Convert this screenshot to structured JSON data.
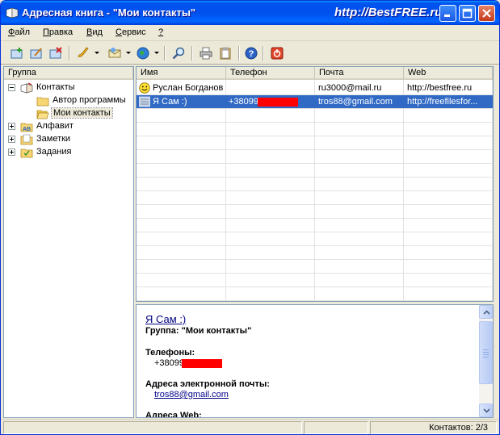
{
  "window": {
    "title": "Адресная книга - \"Мои контакты\"",
    "brand": "http://BestFREE.ru"
  },
  "menu": [
    {
      "label": "Файл",
      "mnemonic": "Ф",
      "rest": "айл"
    },
    {
      "label": "Правка",
      "mnemonic": "П",
      "rest": "равка"
    },
    {
      "label": "Вид",
      "mnemonic": "В",
      "rest": "ид"
    },
    {
      "label": "Сервис",
      "mnemonic": "С",
      "rest": "ервис"
    },
    {
      "label": "?",
      "mnemonic": "?",
      "rest": ""
    }
  ],
  "toolbar": {
    "icons": [
      "new-contact-icon",
      "edit-contact-icon",
      "delete-contact-icon",
      "phone-icon",
      "email-icon",
      "web-icon",
      "search-icon",
      "print-icon",
      "clipboard-icon",
      "help-icon",
      "exit-icon"
    ]
  },
  "tree": {
    "header": "Группа",
    "items": [
      {
        "label": "Контакты",
        "level": 0,
        "expanded": true
      },
      {
        "label": "Автор программы",
        "level": 1
      },
      {
        "label": "Мои контакты",
        "level": 1,
        "selected": true
      },
      {
        "label": "Алфавит",
        "level": 0,
        "expanded": false
      },
      {
        "label": "Заметки",
        "level": 0,
        "expanded": false
      },
      {
        "label": "Задания",
        "level": 0,
        "expanded": false
      }
    ]
  },
  "grid": {
    "columns": [
      "Имя",
      "Телефон",
      "Почта",
      "Web"
    ],
    "rows": [
      {
        "name": "Руслан Богданов",
        "phone": "",
        "email": "ru3000@mail.ru",
        "web": "http://bestfree.ru",
        "selected": false
      },
      {
        "name": "Я Сам :)",
        "phone": "+38099",
        "email": "tros88@gmail.com",
        "web": "http://freefilesfor...",
        "selected": true
      }
    ]
  },
  "detail": {
    "name": "Я Сам :)",
    "group_line": "Группа: \"Мои контакты\"",
    "phones_label": "Телефоны:",
    "phone": "+38099",
    "emails_label": "Адреса электронной почты:",
    "email": "tros88@gmail.com",
    "web_label": "Адреса Web:"
  },
  "status": {
    "count": "Контактов: 2/3"
  },
  "colors": {
    "selection": "#316ac5",
    "redaction": "#ff0000",
    "titlebar": "#0053ee"
  }
}
